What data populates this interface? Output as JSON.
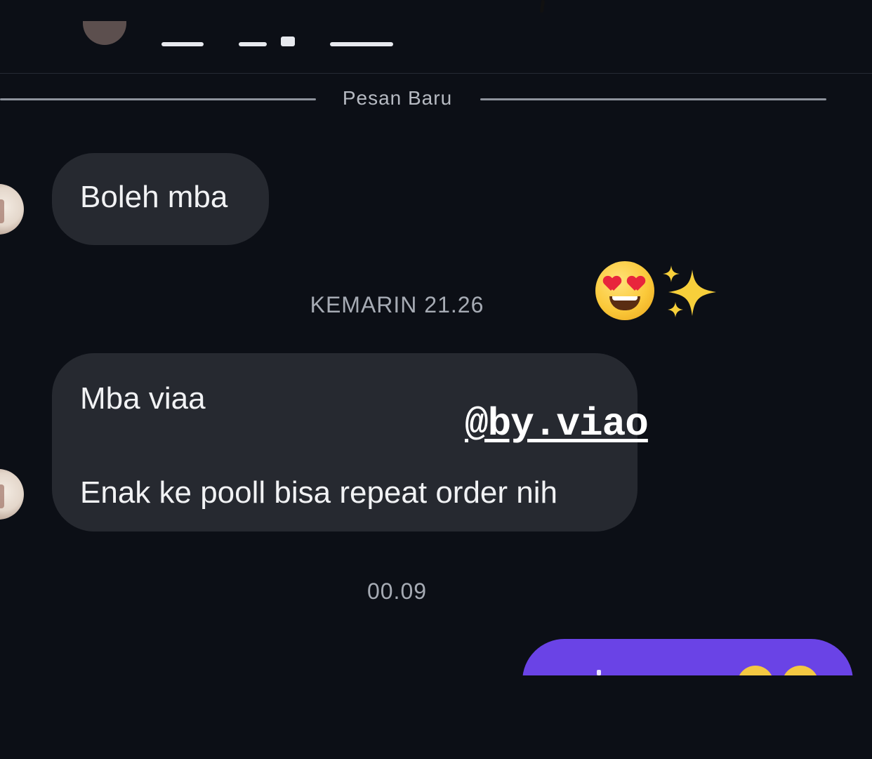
{
  "divider": {
    "label": "Pesan Baru"
  },
  "messages": [
    {
      "sender": "other",
      "lines": [
        "Boleh mba"
      ]
    },
    {
      "sender": "other",
      "lines": [
        "Mba viaa",
        "Enak ke pooll bisa repeat order nih"
      ]
    }
  ],
  "timestamps": {
    "first": "KEMARIN 21.26",
    "second": "00.09"
  },
  "overlay": {
    "watermark": "@by.viao",
    "sticker_icons": [
      "heart-eyes-emoji-icon",
      "sparkles-icon"
    ]
  },
  "colors": {
    "background": "#0c0f16",
    "incoming_bubble": "#262930",
    "outgoing_bubble": "#6a43e6",
    "meta_text": "#a6abb4"
  }
}
